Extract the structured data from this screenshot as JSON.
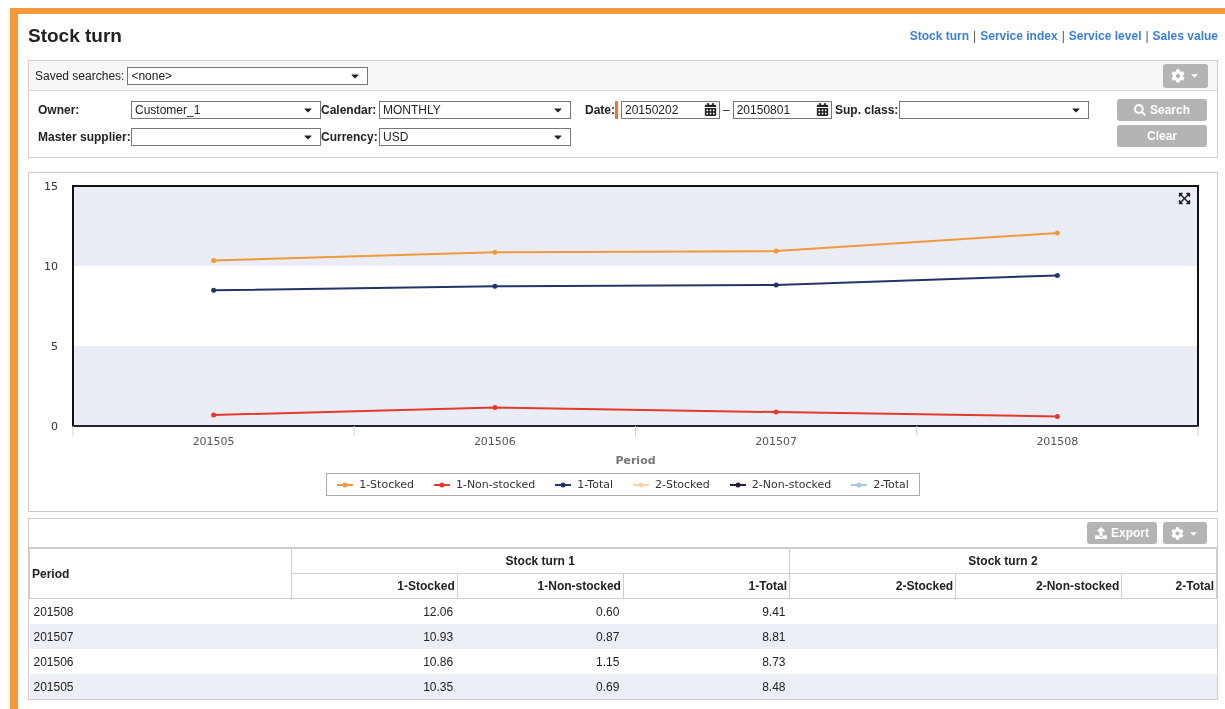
{
  "page_title": "Stock turn",
  "nav_links": {
    "separator": "|",
    "items": [
      "Stock turn",
      "Service index",
      "Service level",
      "Sales value"
    ]
  },
  "saved_searches": {
    "label": "Saved searches:",
    "value": "<none>"
  },
  "filters": [
    {
      "kind": "select",
      "label": "Owner:",
      "value": "Customer_1",
      "required": false
    },
    {
      "kind": "select",
      "label": "Calendar:",
      "value": "MONTHLY",
      "required": false
    },
    {
      "kind": "date_range",
      "label": "Date:",
      "from": "20150202",
      "separator": "–",
      "to": "20150801",
      "required": true
    },
    {
      "kind": "select",
      "label": "Sup. class:",
      "required": false
    },
    {
      "kind": "select",
      "label": "Master supplier:",
      "required": false
    },
    {
      "kind": "select",
      "label": "Currency:",
      "value": "USD",
      "required": false
    }
  ],
  "buttons": [
    {
      "kind": "search",
      "label": "Search"
    },
    {
      "kind": "plain",
      "label": "Clear"
    }
  ],
  "chart": {
    "chart_data": {
      "type": "line",
      "xlabel": "Period",
      "categories": [
        "201505",
        "201506",
        "201507",
        "201508"
      ],
      "ylim": [
        0,
        15
      ],
      "yticks": [
        0,
        5,
        10,
        15
      ],
      "series": [
        {
          "name": "1-Stocked",
          "color": "#f09a3a",
          "values": [
            10.35,
            10.86,
            10.93,
            12.06
          ]
        },
        {
          "name": "1-Non-stocked",
          "color": "#e33a2c",
          "values": [
            0.69,
            1.15,
            0.87,
            0.6
          ]
        },
        {
          "name": "1-Total",
          "color": "#23346b",
          "values": [
            8.48,
            8.73,
            8.81,
            9.41
          ]
        },
        {
          "name": "2-Stocked",
          "color": "#f8d3a4",
          "values": [
            null,
            null,
            null,
            null
          ]
        },
        {
          "name": "2-Non-stocked",
          "color": "#2d1a38",
          "values": [
            null,
            null,
            null,
            null
          ]
        },
        {
          "name": "2-Total",
          "color": "#a8c8e8",
          "values": [
            null,
            null,
            null,
            null
          ]
        }
      ]
    }
  },
  "table": {
    "export_label": "Export",
    "first_column": "Period",
    "groups": [
      {
        "label": "Stock turn 1",
        "columns": [
          "1-Stocked",
          "1-Non-stocked",
          "1-Total"
        ]
      },
      {
        "label": "Stock turn 2",
        "columns": [
          "2-Stocked",
          "2-Non-stocked",
          "2-Total"
        ]
      }
    ],
    "rows": [
      {
        "period": "201508",
        "values": [
          "12.06",
          "0.60",
          "9.41"
        ]
      },
      {
        "period": "201507",
        "values": [
          "10.93",
          "0.87",
          "8.81"
        ]
      },
      {
        "period": "201506",
        "values": [
          "10.86",
          "1.15",
          "8.73"
        ]
      },
      {
        "period": "201505",
        "values": [
          "10.35",
          "0.69",
          "8.48"
        ]
      }
    ]
  }
}
